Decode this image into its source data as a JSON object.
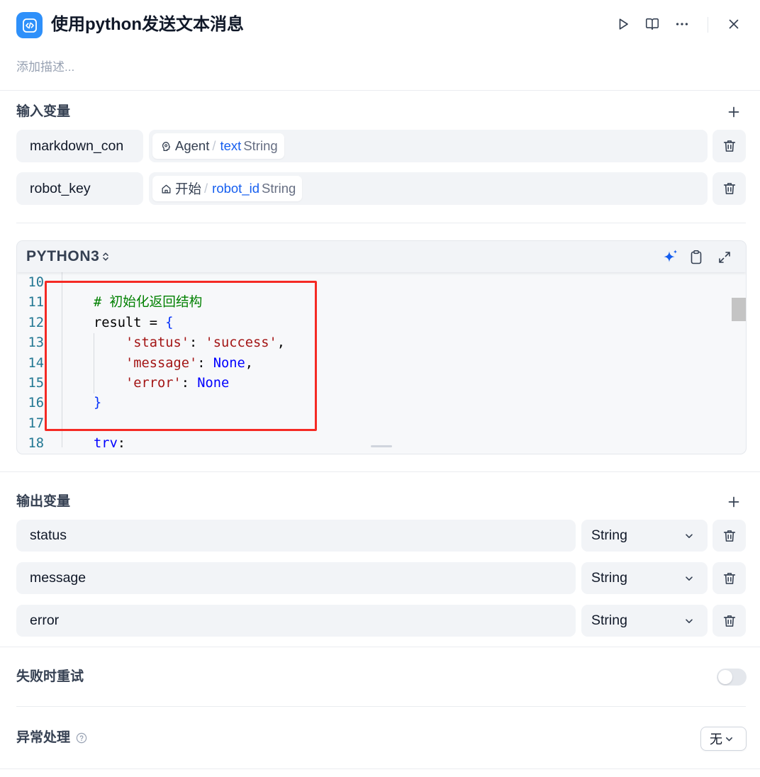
{
  "colors": {
    "accent": "#155eef",
    "node_icon_bg": "#2e90fa",
    "field_bg": "#f2f4f7",
    "annotation": "#f52a24"
  },
  "header": {
    "node_icon": "code-icon",
    "title": "使用python发送文本消息",
    "description_placeholder": "添加描述..."
  },
  "input_vars": {
    "title": "输入变量",
    "items": [
      {
        "name": "markdown_con",
        "node_icon": "agent-icon",
        "node": "Agent",
        "sep": "/",
        "var": "text",
        "type": "String"
      },
      {
        "name": "robot_key",
        "node_icon": "home-icon",
        "node": "开始",
        "sep": "/",
        "var": "robot_id",
        "type": "String"
      }
    ]
  },
  "code": {
    "language": "PYTHON3",
    "theme": {
      "text": "#000000",
      "comment": "#008000",
      "string": "#a31515",
      "constant": "#0000ff",
      "bracket": "#0431fa",
      "keyword": "#0000ff",
      "line_number": "#237893"
    },
    "lines": [
      {
        "n": "10",
        "tokens": []
      },
      {
        "n": "11",
        "tokens": [
          [
            "    # 初始化返回结构",
            "comment"
          ]
        ]
      },
      {
        "n": "12",
        "tokens": [
          [
            "    result = ",
            "text"
          ],
          [
            "{",
            "bracket"
          ]
        ]
      },
      {
        "n": "13",
        "tokens": [
          [
            "        'status'",
            "string"
          ],
          [
            ": ",
            "text"
          ],
          [
            "'success'",
            "string"
          ],
          [
            ",",
            "text"
          ]
        ]
      },
      {
        "n": "14",
        "tokens": [
          [
            "        'message'",
            "string"
          ],
          [
            ": ",
            "text"
          ],
          [
            "None",
            "constant"
          ],
          [
            ",",
            "text"
          ]
        ]
      },
      {
        "n": "15",
        "tokens": [
          [
            "        'error'",
            "string"
          ],
          [
            ": ",
            "text"
          ],
          [
            "None",
            "constant"
          ]
        ]
      },
      {
        "n": "16",
        "tokens": [
          [
            "    }",
            "bracket"
          ]
        ]
      },
      {
        "n": "17",
        "tokens": []
      },
      {
        "n": "18",
        "tokens": [
          [
            "    try",
            "keyword"
          ],
          [
            ":",
            "text"
          ]
        ]
      }
    ]
  },
  "output_vars": {
    "title": "输出变量",
    "items": [
      {
        "name": "status",
        "type": "String"
      },
      {
        "name": "message",
        "type": "String"
      },
      {
        "name": "error",
        "type": "String"
      }
    ]
  },
  "retry": {
    "label": "失败时重试",
    "enabled": false
  },
  "error_handling": {
    "label": "异常处理",
    "value": "无"
  }
}
